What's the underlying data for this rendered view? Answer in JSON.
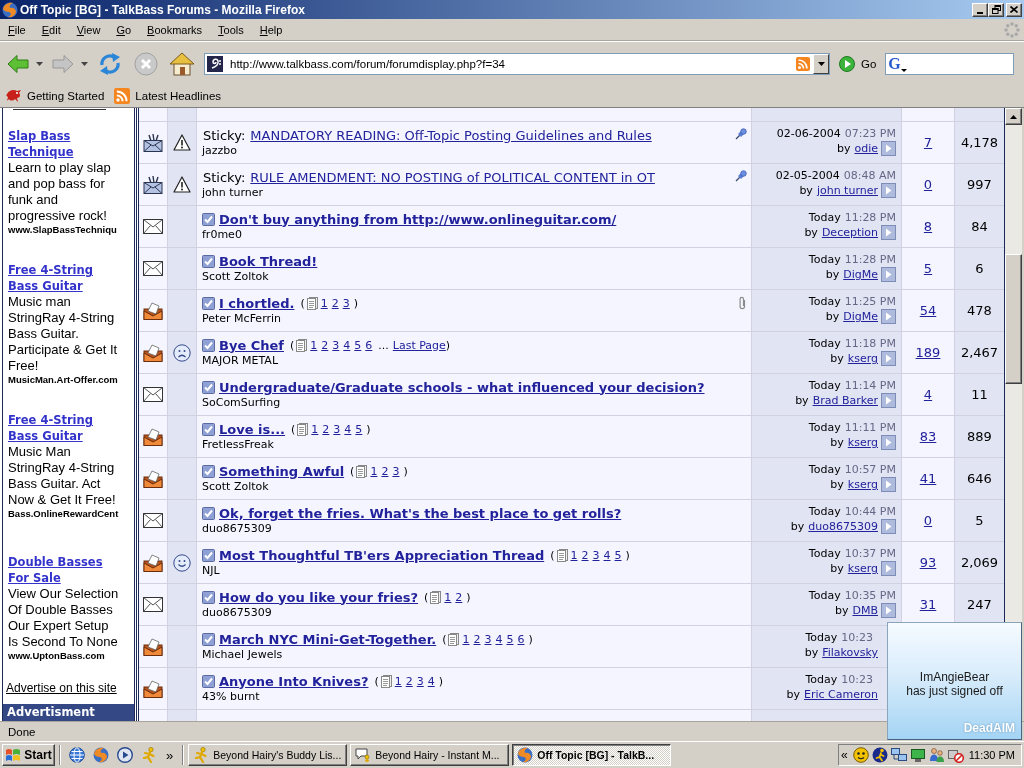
{
  "window": {
    "title": "Off Topic [BG] - TalkBass Forums - Mozilla Firefox"
  },
  "menu": [
    "File",
    "Edit",
    "View",
    "Go",
    "Bookmarks",
    "Tools",
    "Help"
  ],
  "toolbar": {
    "buttons": [
      {
        "kind": "back",
        "disabled": false
      },
      {
        "kind": "forward",
        "disabled": true
      },
      {
        "kind": "reload",
        "disabled": false
      },
      {
        "kind": "stop",
        "disabled": true
      },
      {
        "kind": "home",
        "disabled": false
      }
    ],
    "address": "http://www.talkbass.com/forum/forumdisplay.php?f=34",
    "go": "Go",
    "search_engine": "G"
  },
  "bookmarks": [
    "Getting Started",
    "Latest Headlines"
  ],
  "sidebar": {
    "ads": [
      {
        "title_lines": [
          "Slap Bass",
          "Technique"
        ],
        "text_lines": [
          "Learn to play slap",
          "and pop bass for",
          "funk and",
          "progressive rock!"
        ],
        "url": "www.SlapBassTechniqu"
      },
      {
        "title_lines": [
          "Free 4-String",
          "Bass Guitar"
        ],
        "text_lines": [
          "Music man",
          "StringRay 4-String",
          "Bass Guitar.",
          "Participate & Get It",
          "Free!"
        ],
        "url": "MusicMan.Art-Offer.com"
      },
      {
        "title_lines": [
          "Free 4-String",
          "Bass Guitar"
        ],
        "text_lines": [
          "Music Man",
          "StringRay 4-String",
          "Bass Guitar. Act",
          "Now & Get It Free!"
        ],
        "url": "Bass.OnlineRewardCent"
      },
      {
        "title_lines": [
          "Double Basses",
          "For Sale"
        ],
        "text_lines": [
          "View Our Selection",
          "Of Double Basses",
          "Our Expert Setup",
          "Is Second To None"
        ],
        "url": "www.UptonBass.com"
      }
    ],
    "advertise_link": "Advertise on this site",
    "heading": "Advertisment"
  },
  "threads": [
    {
      "kind": "sticky",
      "post_icon": {
        "kind": "warning"
      },
      "prefix": "Sticky:",
      "title": "MANDATORY READING: Off-Topic Posting Guidelines and Rules",
      "author": "jazzbo",
      "attachment": false,
      "last_post": {
        "date": "02-06-2004",
        "time": "07:23 PM",
        "by": "by",
        "user": "odie",
        "arrow": true
      },
      "replies": "7",
      "views": "4,178"
    },
    {
      "kind": "sticky",
      "post_icon": {
        "kind": "warning"
      },
      "prefix": "Sticky:",
      "title": "RULE AMENDMENT: NO POSTING of POLITICAL CONTENT in OT",
      "author": "john turner",
      "attachment": false,
      "last_post": {
        "date": "02-05-2004",
        "time": "08:48 AM",
        "by": "by",
        "user": "john turner",
        "arrow": true
      },
      "replies": "0",
      "views": "997"
    },
    {
      "kind": "plain",
      "title": "Don't buy anything from http://www.onlineguitar.com/",
      "author": "fr0me0",
      "attachment": false,
      "last_post": {
        "date": "Today",
        "time": "11:28 PM",
        "by": "by",
        "user": "Deception",
        "arrow": true
      },
      "replies": "8",
      "views": "84"
    },
    {
      "kind": "plain",
      "title": "Book Thread!",
      "author": "Scott Zoltok",
      "attachment": false,
      "last_post": {
        "date": "Today",
        "time": "11:28 PM",
        "by": "by",
        "user": "DigMe",
        "arrow": true
      },
      "replies": "5",
      "views": "6"
    },
    {
      "kind": "hot",
      "title": "I chortled.",
      "pages": {
        "open": "(",
        "numbers": [
          "1",
          "2",
          "3"
        ],
        "close": ")"
      },
      "author": "Peter McFerrin",
      "attachment": true,
      "last_post": {
        "date": "Today",
        "time": "11:25 PM",
        "by": "by",
        "user": "DigMe",
        "arrow": true
      },
      "replies": "54",
      "views": "478"
    },
    {
      "kind": "hot",
      "post_icon": {
        "kind": "frown"
      },
      "title": "Bye Chef",
      "pages": {
        "open": "(",
        "numbers": [
          "1",
          "2",
          "3",
          "4",
          "5",
          "6"
        ],
        "gap": "...",
        "last": "Last Page",
        "close": ")"
      },
      "author": "MAJOR METAL",
      "attachment": false,
      "last_post": {
        "date": "Today",
        "time": "11:18 PM",
        "by": "by",
        "user": "kserg",
        "arrow": true
      },
      "replies": "189",
      "views": "2,467"
    },
    {
      "kind": "plain",
      "title": "Undergraduate/Graduate schools - what influenced your decision?",
      "author": "SoComSurfing",
      "attachment": false,
      "last_post": {
        "date": "Today",
        "time": "11:14 PM",
        "by": "by",
        "user": "Brad Barker",
        "arrow": true
      },
      "replies": "4",
      "views": "11"
    },
    {
      "kind": "hot",
      "title": "Love is...",
      "pages": {
        "open": "(",
        "numbers": [
          "1",
          "2",
          "3",
          "4",
          "5"
        ],
        "close": ")"
      },
      "author": "FretlessFreak",
      "attachment": false,
      "last_post": {
        "date": "Today",
        "time": "11:11 PM",
        "by": "by",
        "user": "kserg",
        "arrow": true
      },
      "replies": "83",
      "views": "889"
    },
    {
      "kind": "hot",
      "title": "Something Awful",
      "pages": {
        "open": "(",
        "numbers": [
          "1",
          "2",
          "3"
        ],
        "close": ")"
      },
      "author": "Scott Zoltok",
      "attachment": false,
      "last_post": {
        "date": "Today",
        "time": "10:57 PM",
        "by": "by",
        "user": "kserg",
        "arrow": true
      },
      "replies": "41",
      "views": "646"
    },
    {
      "kind": "plain",
      "title": "Ok, forget the fries. What's the best place to get rolls?",
      "author": "duo8675309",
      "attachment": false,
      "last_post": {
        "date": "Today",
        "time": "10:44 PM",
        "by": "by",
        "user": "duo8675309",
        "arrow": true
      },
      "replies": "0",
      "views": "5"
    },
    {
      "kind": "hot",
      "post_icon": {
        "kind": "smile"
      },
      "title": "Most Thoughtful TB'ers Appreciation Thread",
      "pages": {
        "open": "(",
        "numbers": [
          "1",
          "2",
          "3",
          "4",
          "5"
        ],
        "close": ")"
      },
      "author": "NJL",
      "attachment": false,
      "last_post": {
        "date": "Today",
        "time": "10:37 PM",
        "by": "by",
        "user": "kserg",
        "arrow": true
      },
      "replies": "93",
      "views": "2,069"
    },
    {
      "kind": "plain",
      "title": "How do you like your fries?",
      "pages": {
        "open": "(",
        "numbers": [
          "1",
          "2"
        ],
        "close": ")"
      },
      "author": "duo8675309",
      "attachment": false,
      "last_post": {
        "date": "Today",
        "time": "10:35 PM",
        "by": "by",
        "user": "DMB",
        "arrow": true
      },
      "replies": "31",
      "views": "247"
    },
    {
      "kind": "hot",
      "title": "March NYC Mini-Get-Together.",
      "pages": {
        "open": "(",
        "numbers": [
          "1",
          "2",
          "3",
          "4",
          "5",
          "6"
        ],
        "close": ")"
      },
      "author": "Michael Jewels",
      "attachment": false,
      "last_post": {
        "date": "Today",
        "time": "10:23",
        "by": "by",
        "user": "Filakovsky",
        "arrow": false
      }
    },
    {
      "kind": "hot",
      "title": "Anyone Into Knives?",
      "pages": {
        "open": "(",
        "numbers": [
          "1",
          "2",
          "3",
          "4"
        ],
        "close": ")"
      },
      "author": "43% burnt",
      "attachment": false,
      "last_post": {
        "date": "Today",
        "time": "10:23",
        "by": "by",
        "user": "Eric Cameron",
        "arrow": false
      }
    }
  ],
  "status_bar": "Done",
  "notification": {
    "screen_name": "ImAngieBear",
    "message": "has just signed off",
    "brand": "DeadAIM"
  },
  "taskbar": {
    "start": "Start",
    "more": "»",
    "tasks": [
      {
        "label": "Beyond Hairy's Buddy Lis...",
        "selected": false
      },
      {
        "label": "Beyond Hairy - Instant M...",
        "selected": false
      },
      {
        "label": "Off Topic [BG] - TalkB...",
        "selected": true
      }
    ],
    "tray_expand": "«",
    "clock": "11:30 PM"
  }
}
